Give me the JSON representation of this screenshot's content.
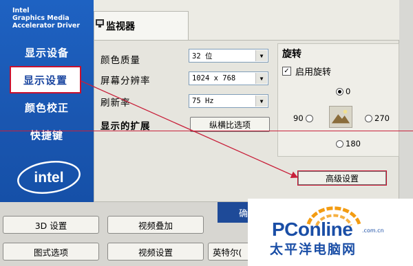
{
  "brand": {
    "line1": "Intel",
    "line2": "Graphics Media",
    "line3": "Accelerator Driver",
    "logo_text": "intel"
  },
  "sidebar": {
    "items": [
      {
        "label": "显示设备"
      },
      {
        "label": "显示设置"
      },
      {
        "label": "颜色校正"
      },
      {
        "label": "快捷键"
      }
    ]
  },
  "tab": {
    "label": "监视器",
    "icon": "monitor-icon"
  },
  "settings": {
    "color_quality": {
      "label": "颜色质量",
      "value": "32 位"
    },
    "resolution": {
      "label": "屏幕分辨率",
      "value": "1024 x 768"
    },
    "refresh": {
      "label": "刷新率",
      "value": "75 Hz"
    },
    "extension_label": "显示的扩展",
    "aspect_button": "纵横比选项"
  },
  "rotation": {
    "title": "旋转",
    "enable_label": "启用旋转",
    "enabled": true,
    "options": [
      "0",
      "90",
      "270",
      "180"
    ],
    "selected": "0"
  },
  "advanced_button": "高级设置",
  "bottom": {
    "buttons": [
      "3D 设置",
      "视频叠加",
      "图式选项",
      "视频设置",
      "英特尔("
    ],
    "blue_tab": "确"
  },
  "watermark": {
    "logo": "PConline",
    "domain": ".com.cn",
    "cn": "太平洋电脑网"
  },
  "colors": {
    "sidebar_blue": "#1e62c2",
    "highlight_red": "#c8102e",
    "watermark_blue": "#1a4ea6"
  }
}
